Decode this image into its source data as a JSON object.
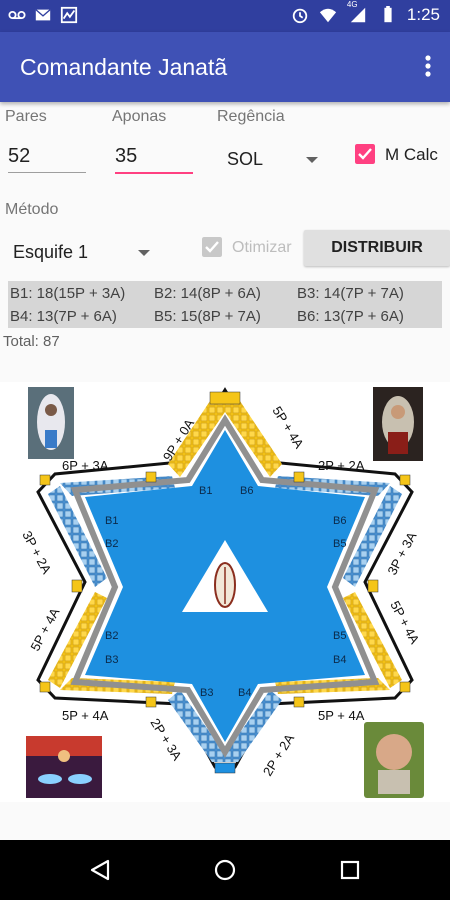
{
  "status_bar": {
    "time": "1:25",
    "network": "4G"
  },
  "app": {
    "title": "Comandante Janatã"
  },
  "form": {
    "pares_label": "Pares",
    "pares_value": "52",
    "aponas_label": "Aponas",
    "aponas_value": "35",
    "regencia_label": "Regência",
    "regencia_value": "SOL",
    "mcalc_label": "M Calc",
    "mcalc_checked": true,
    "metodo_label": "Método",
    "metodo_value": "Esquife 1",
    "otimizar_label": "Otimizar",
    "otimizar_checked": true,
    "otimizar_enabled": false,
    "distribuir_label": "DISTRIBUIR"
  },
  "results": {
    "row1": [
      "B1: 18(15P + 3A)",
      "B2: 14(8P + 6A)",
      "B3: 14(7P + 7A)"
    ],
    "row2": [
      "B4: 13(7P + 6A)",
      "B5: 15(8P + 7A)",
      "B6: 13(7P + 6A)"
    ],
    "total": "Total: 87"
  },
  "diagram": {
    "side_labels": [
      "9P + 0A",
      "5P + 4A",
      "6P + 3A",
      "2P + 2A",
      "3P + 2A",
      "3P + 3A",
      "5P + 4A",
      "5P + 4A",
      "5P + 4A",
      "5P + 4A",
      "2P + 3A",
      "2P + 2A"
    ],
    "block_labels": [
      "B1",
      "B6",
      "B1",
      "B6",
      "B2",
      "B5",
      "B2",
      "B5",
      "B3",
      "B4",
      "B3",
      "B4"
    ],
    "colors": {
      "star_blue": "#1e90e0",
      "path_gray": "#909090",
      "yellow": "#f5c518",
      "light_blue": "#7fb8e6",
      "track_black": "#111111"
    }
  },
  "colors": {
    "status": "#303f9f",
    "primary": "#3f51b5",
    "accent": "#ff4081",
    "nav": "#000000"
  }
}
